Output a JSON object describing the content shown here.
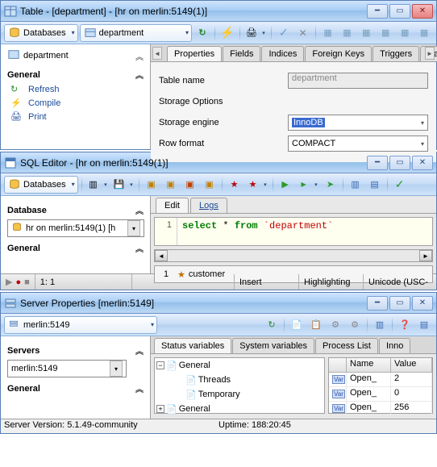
{
  "window1": {
    "title": "Table - [department] - [hr on merlin:5149(1)]",
    "toolbar": {
      "databases_label": "Databases",
      "combo2": "department"
    },
    "sidebar": {
      "tree_item": "department",
      "general_header": "General",
      "refresh": "Refresh",
      "compile": "Compile",
      "print": "Print"
    },
    "tabs": [
      "Properties",
      "Fields",
      "Indices",
      "Foreign Keys",
      "Triggers",
      "Da"
    ],
    "form": {
      "table_name_label": "Table name",
      "table_name_value": "department",
      "storage_options_label": "Storage Options",
      "storage_engine_label": "Storage engine",
      "storage_engine_value": "InnoDB",
      "row_format_label": "Row format",
      "row_format_value": "COMPACT"
    }
  },
  "window2": {
    "title": "SQL Editor - [hr on merlin:5149(1)]",
    "toolbar": {
      "databases_label": "Databases"
    },
    "sidebar": {
      "database_header": "Database",
      "db_value": "hr on merlin:5149(1) [h",
      "general_header": "General"
    },
    "editor_tabs": [
      "Edit",
      "Logs"
    ],
    "code": {
      "line_no": "1",
      "kw1": "select",
      "op": " * ",
      "kw2": "from",
      "str": " `department`"
    },
    "result_tab": {
      "num": "1",
      "label": "customer"
    },
    "status": {
      "pos": "1:   1",
      "mode": "Insert",
      "hl": "Highlighting",
      "enc": "Unicode (USC-"
    }
  },
  "window3": {
    "title": "Server Properties [merlin:5149]",
    "toolbar": {
      "combo_value": "merlin:5149"
    },
    "sidebar": {
      "servers_header": "Servers",
      "server_value": "merlin:5149",
      "general_header": "General"
    },
    "tabs": [
      "Status variables",
      "System variables",
      "Process List",
      "Inno"
    ],
    "tree": [
      {
        "exp": "-",
        "label": "General",
        "indent": 0
      },
      {
        "exp": "",
        "label": "Threads",
        "indent": 1
      },
      {
        "exp": "",
        "label": "Temporary",
        "indent": 1
      },
      {
        "exp": "+",
        "label": "General",
        "indent": 0
      }
    ],
    "grid": {
      "headers": [
        "Name",
        "Value"
      ],
      "rows": [
        {
          "name": "Open_",
          "value": "2"
        },
        {
          "name": "Open_",
          "value": "0"
        },
        {
          "name": "Open_",
          "value": "256"
        }
      ]
    },
    "footer": {
      "version": "Server Version: 5.1.49-community",
      "uptime": "Uptime: 188:20:45"
    }
  }
}
